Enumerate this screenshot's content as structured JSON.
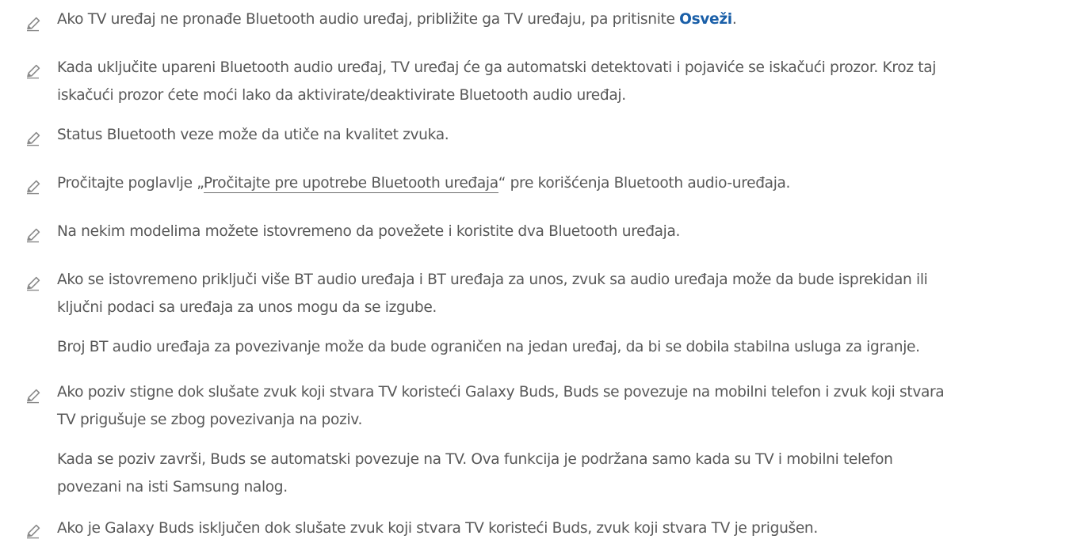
{
  "colors": {
    "text": "#585858",
    "accent": "#1a5fa8",
    "icon": "#8a8a8a"
  },
  "notes": [
    {
      "icon": "pencil-icon",
      "lines": [
        {
          "pre": "Ako TV uređaj ne pronađe Bluetooth audio uređaj, približite ga TV uređaju, pa pritisnite ",
          "accent": "Osveži",
          "post": "."
        }
      ]
    },
    {
      "icon": "pencil-icon",
      "lines": [
        "Kada uključite upareni Bluetooth audio uređaj, TV uređaj će ga automatski detektovati i pojaviće se iskačući prozor. Kroz taj",
        "iskačući prozor ćete moći lako da aktivirate/deaktivirate Bluetooth audio uređaj."
      ]
    },
    {
      "icon": "pencil-icon",
      "lines": [
        "Status Bluetooth veze može da utiče na kvalitet zvuka."
      ]
    },
    {
      "icon": "pencil-icon",
      "lines": [
        {
          "pre": "Pročitajte poglavlje „",
          "link": "Pročitajte pre upotrebe Bluetooth uređaja",
          "post": "“ pre korišćenja Bluetooth audio-uređaja."
        }
      ]
    },
    {
      "icon": "pencil-icon",
      "lines": [
        "Na nekim modelima možete istovremeno da povežete i koristite dva Bluetooth uređaja."
      ]
    },
    {
      "icon": "pencil-icon",
      "lines": [
        "Ako se istovremeno priključi više BT audio uređaja i BT uređaja za unos, zvuk sa audio uređaja može da bude isprekidan ili",
        "ključni podaci sa uređaja za unos mogu da se izgube."
      ],
      "extra": [
        "Broj BT audio uređaja za povezivanje može da bude ograničen na jedan uređaj, da bi se dobila stabilna usluga za igranje."
      ]
    },
    {
      "icon": "pencil-icon",
      "lines": [
        "Ako poziv stigne dok slušate zvuk koji stvara TV koristeći Galaxy Buds, Buds se povezuje na mobilni telefon i zvuk koji stvara",
        "TV prigušuje se zbog povezivanja na poziv."
      ],
      "extra": [
        "Kada se poziv završi, Buds se automatski povezuje na TV. Ova funkcija je podržana samo kada su TV i mobilni telefon",
        "povezani na isti Samsung nalog."
      ]
    },
    {
      "icon": "pencil-icon",
      "lines": [
        "Ako je Galaxy Buds isključen dok slušate zvuk koji stvara TV koristeći Buds, zvuk koji stvara TV je prigušen."
      ]
    }
  ]
}
